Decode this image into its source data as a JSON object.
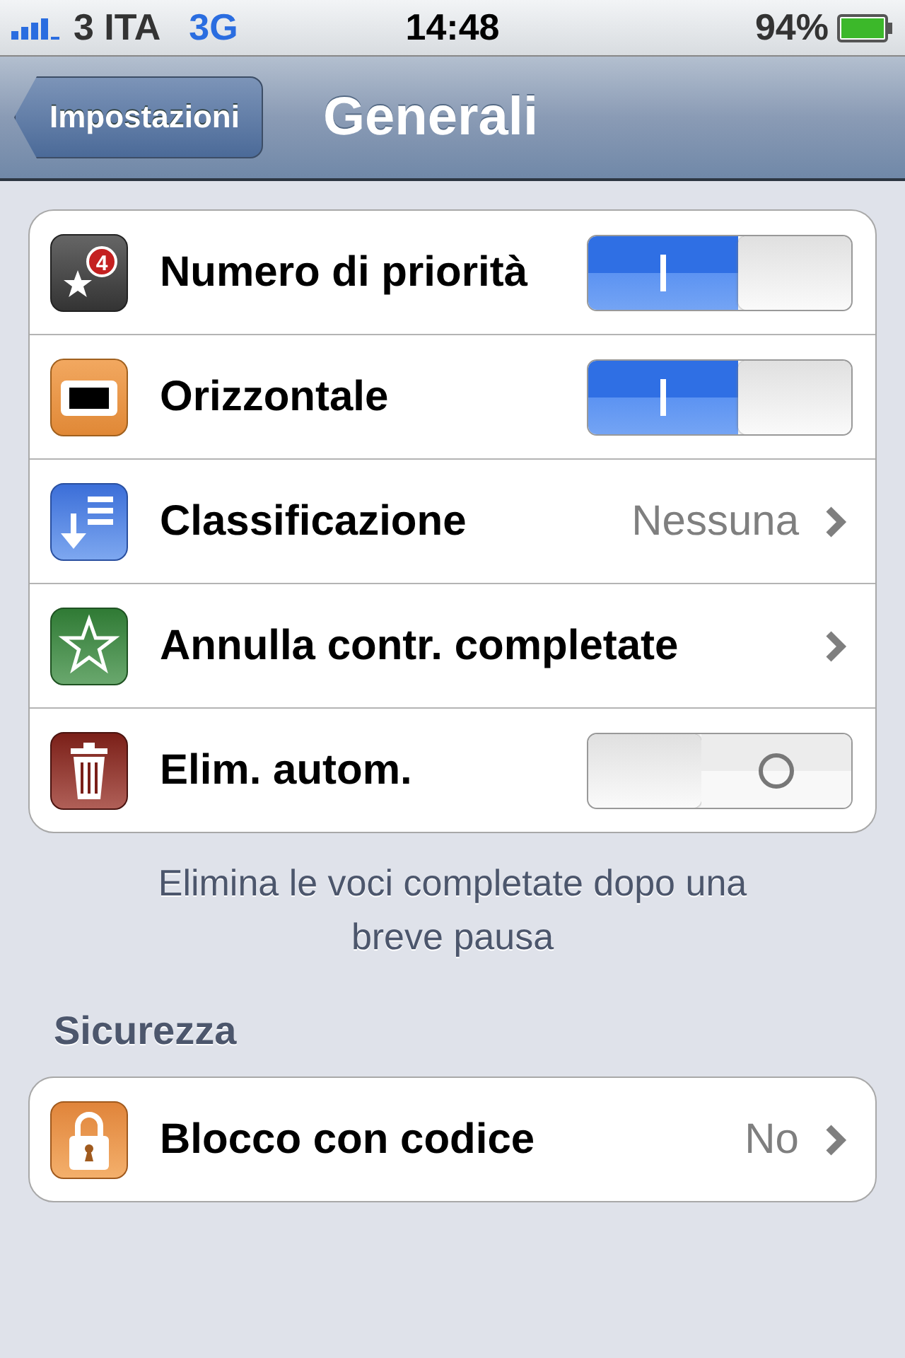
{
  "status_bar": {
    "carrier": "3 ITA",
    "network": "3G",
    "time": "14:48",
    "battery": "94%"
  },
  "nav_bar": {
    "back_button": "Impostazioni",
    "title": "Generali"
  },
  "groups": [
    {
      "rows": [
        {
          "kind": "switch",
          "label": "Numero di priorità",
          "badge": "4",
          "on": true
        },
        {
          "kind": "switch",
          "label": "Orizzontale",
          "on": true
        },
        {
          "kind": "link",
          "label": "Classificazione",
          "value": "Nessuna"
        },
        {
          "kind": "link",
          "label": "Annulla contr. completate"
        },
        {
          "kind": "switch",
          "label": "Elim. autom.",
          "on": false
        }
      ],
      "footer": "Elimina le voci completate dopo una breve pausa"
    },
    {
      "header": "Sicurezza",
      "rows": [
        {
          "kind": "link",
          "label": "Blocco con codice",
          "value": "No"
        }
      ]
    }
  ]
}
